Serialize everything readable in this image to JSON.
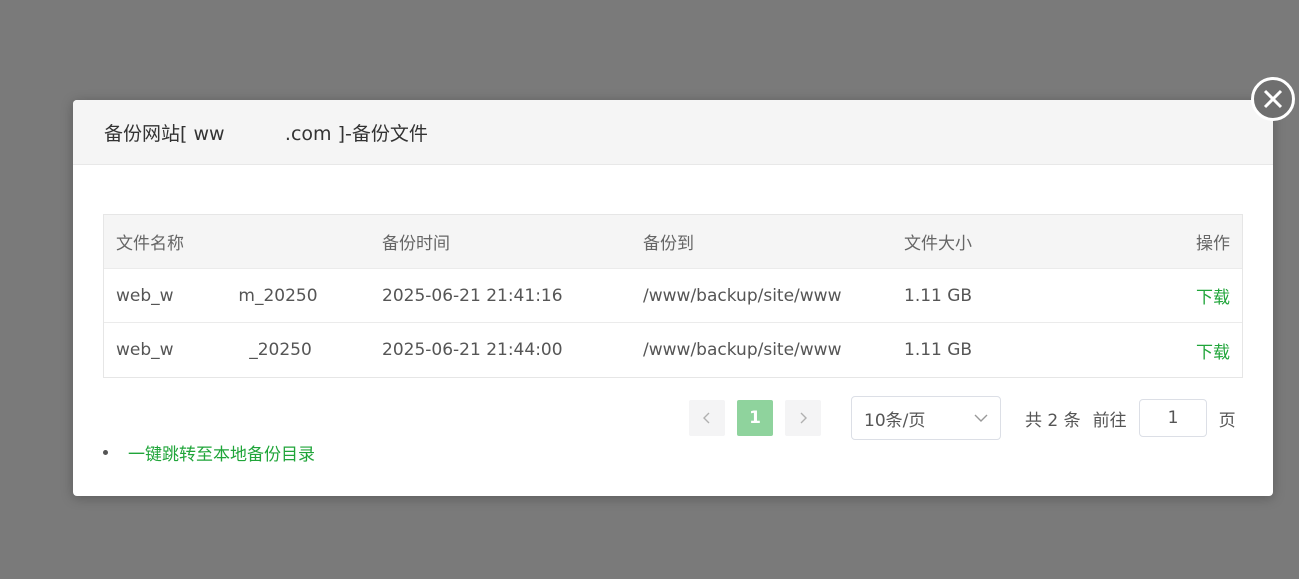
{
  "dialog": {
    "title": "备份网站[ ww          .com ]-备份文件"
  },
  "table": {
    "headers": [
      "文件名称",
      "备份时间",
      "备份到",
      "文件大小",
      "操作"
    ],
    "rows": [
      {
        "name": "web_w            m_20250",
        "time": "2025-06-21 21:41:16",
        "path": "/www/backup/site/www",
        "size": "1.11 GB",
        "action": "下载"
      },
      {
        "name": "web_w              _20250",
        "time": "2025-06-21 21:44:00",
        "path": "/www/backup/site/www",
        "size": "1.11 GB",
        "action": "下载"
      }
    ]
  },
  "pagination": {
    "prev_icon": "chevron-left-icon",
    "next_icon": "chevron-right-icon",
    "current_page": "1",
    "page_size": "10条/页",
    "total": "共 2 条",
    "goto_label": "前往",
    "goto_value": "1",
    "page_unit": "页"
  },
  "footer": {
    "link": "一键跳转至本地备份目录"
  },
  "colors": {
    "accent": "#20a53a",
    "active_page": "#8fd39d",
    "overlay": "#7a7a7a"
  }
}
